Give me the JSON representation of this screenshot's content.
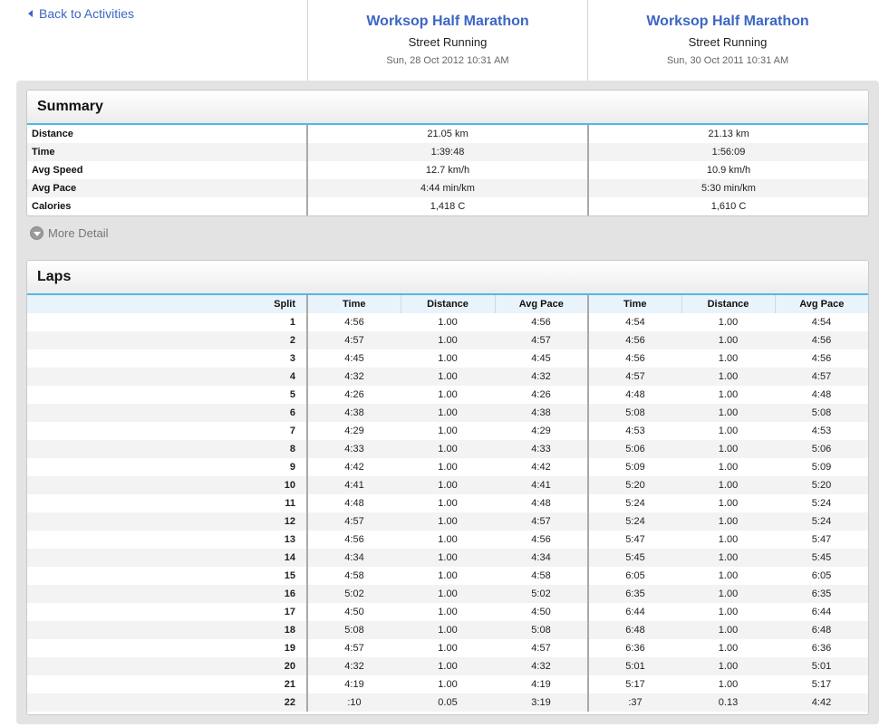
{
  "nav": {
    "back_label": "Back to Activities"
  },
  "activities": [
    {
      "title": "Worksop Half Marathon",
      "type": "Street Running",
      "date": "Sun, 28 Oct 2012 10:31 AM"
    },
    {
      "title": "Worksop Half Marathon",
      "type": "Street Running",
      "date": "Sun, 30 Oct 2011 10:31 AM"
    }
  ],
  "summary": {
    "title": "Summary",
    "rows": [
      {
        "label": "Distance",
        "a": "21.05 km",
        "b": "21.13 km"
      },
      {
        "label": "Time",
        "a": "1:39:48",
        "b": "1:56:09"
      },
      {
        "label": "Avg Speed",
        "a": "12.7 km/h",
        "b": "10.9 km/h"
      },
      {
        "label": "Avg Pace",
        "a": "4:44 min/km",
        "b": "5:30 min/km"
      },
      {
        "label": "Calories",
        "a": "1,418 C",
        "b": "1,610 C"
      }
    ],
    "more_detail": "More Detail"
  },
  "laps": {
    "title": "Laps",
    "headers": {
      "split": "Split",
      "time": "Time",
      "distance": "Distance",
      "pace": "Avg Pace"
    },
    "rows": [
      [
        "1",
        "4:56",
        "1.00",
        "4:56",
        "4:54",
        "1.00",
        "4:54"
      ],
      [
        "2",
        "4:57",
        "1.00",
        "4:57",
        "4:56",
        "1.00",
        "4:56"
      ],
      [
        "3",
        "4:45",
        "1.00",
        "4:45",
        "4:56",
        "1.00",
        "4:56"
      ],
      [
        "4",
        "4:32",
        "1.00",
        "4:32",
        "4:57",
        "1.00",
        "4:57"
      ],
      [
        "5",
        "4:26",
        "1.00",
        "4:26",
        "4:48",
        "1.00",
        "4:48"
      ],
      [
        "6",
        "4:38",
        "1.00",
        "4:38",
        "5:08",
        "1.00",
        "5:08"
      ],
      [
        "7",
        "4:29",
        "1.00",
        "4:29",
        "4:53",
        "1.00",
        "4:53"
      ],
      [
        "8",
        "4:33",
        "1.00",
        "4:33",
        "5:06",
        "1.00",
        "5:06"
      ],
      [
        "9",
        "4:42",
        "1.00",
        "4:42",
        "5:09",
        "1.00",
        "5:09"
      ],
      [
        "10",
        "4:41",
        "1.00",
        "4:41",
        "5:20",
        "1.00",
        "5:20"
      ],
      [
        "11",
        "4:48",
        "1.00",
        "4:48",
        "5:24",
        "1.00",
        "5:24"
      ],
      [
        "12",
        "4:57",
        "1.00",
        "4:57",
        "5:24",
        "1.00",
        "5:24"
      ],
      [
        "13",
        "4:56",
        "1.00",
        "4:56",
        "5:47",
        "1.00",
        "5:47"
      ],
      [
        "14",
        "4:34",
        "1.00",
        "4:34",
        "5:45",
        "1.00",
        "5:45"
      ],
      [
        "15",
        "4:58",
        "1.00",
        "4:58",
        "6:05",
        "1.00",
        "6:05"
      ],
      [
        "16",
        "5:02",
        "1.00",
        "5:02",
        "6:35",
        "1.00",
        "6:35"
      ],
      [
        "17",
        "4:50",
        "1.00",
        "4:50",
        "6:44",
        "1.00",
        "6:44"
      ],
      [
        "18",
        "5:08",
        "1.00",
        "5:08",
        "6:48",
        "1.00",
        "6:48"
      ],
      [
        "19",
        "4:57",
        "1.00",
        "4:57",
        "6:36",
        "1.00",
        "6:36"
      ],
      [
        "20",
        "4:32",
        "1.00",
        "4:32",
        "5:01",
        "1.00",
        "5:01"
      ],
      [
        "21",
        "4:19",
        "1.00",
        "4:19",
        "5:17",
        "1.00",
        "5:17"
      ],
      [
        "22",
        ":10",
        "0.05",
        "3:19",
        ":37",
        "0.13",
        "4:42"
      ]
    ]
  }
}
